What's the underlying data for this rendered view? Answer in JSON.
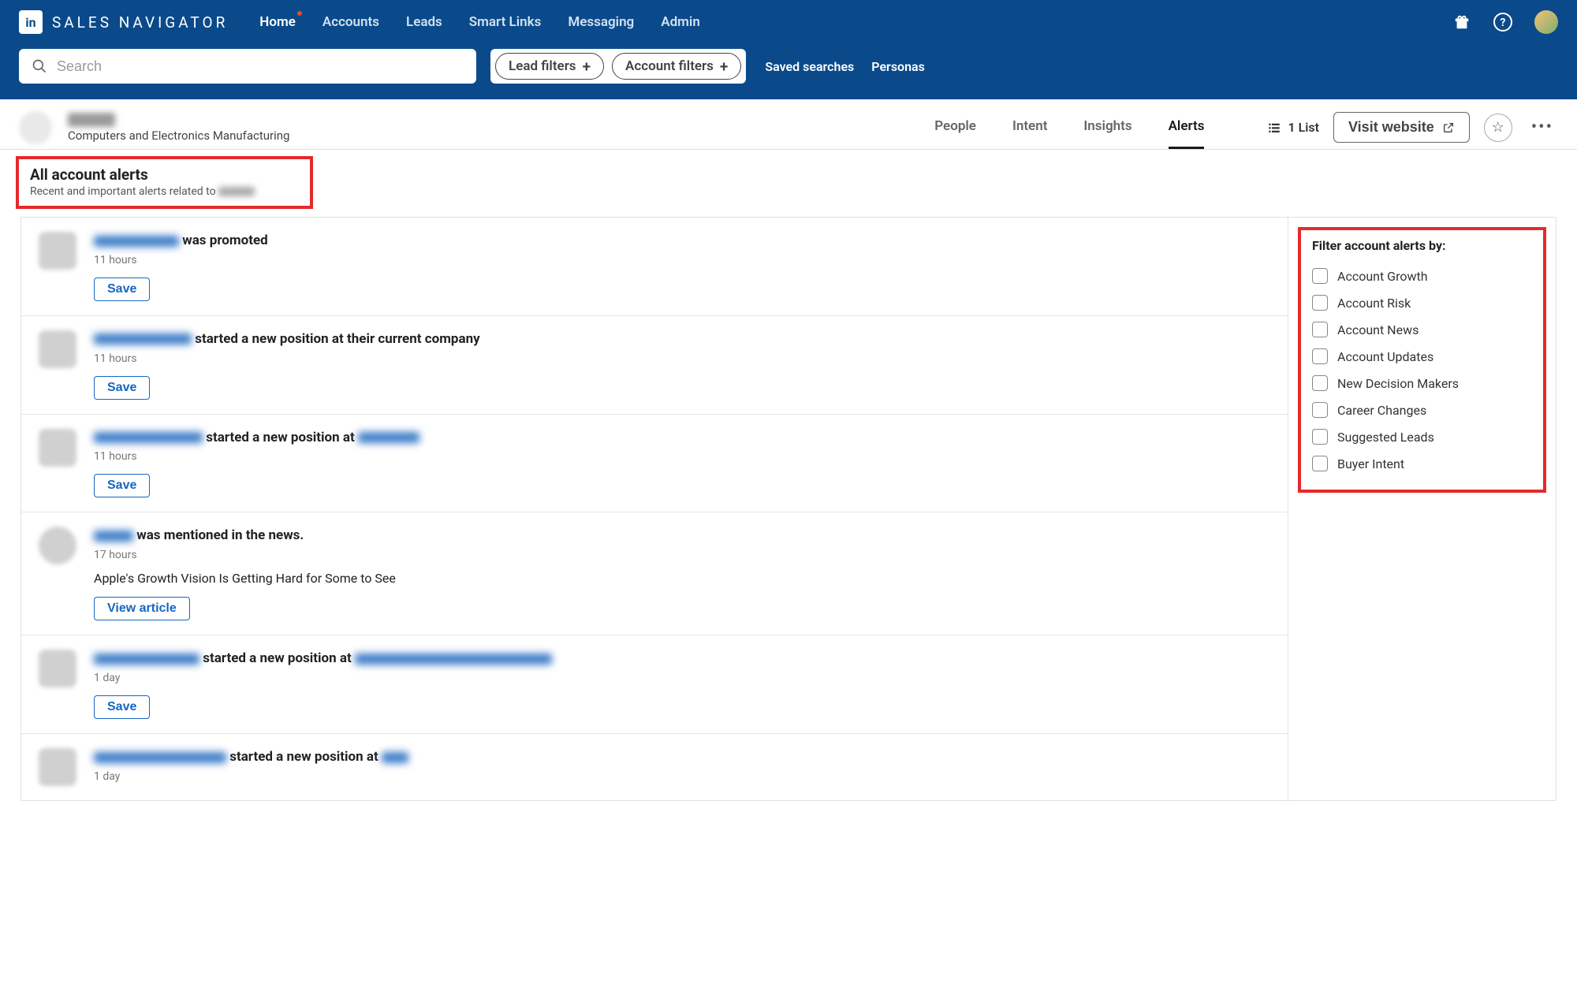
{
  "brand": {
    "logo_text": "SALES NAVIGATOR",
    "logo_abbr": "in"
  },
  "nav": {
    "items": [
      {
        "label": "Home",
        "active": true,
        "dot": true
      },
      {
        "label": "Accounts"
      },
      {
        "label": "Leads"
      },
      {
        "label": "Smart Links"
      },
      {
        "label": "Messaging"
      },
      {
        "label": "Admin"
      }
    ]
  },
  "search": {
    "placeholder": "Search",
    "lead_filters": "Lead filters",
    "account_filters": "Account filters",
    "saved_searches": "Saved searches",
    "personas": "Personas"
  },
  "account": {
    "industry": "Computers and Electronics Manufacturing",
    "tabs": [
      "People",
      "Intent",
      "Insights",
      "Alerts"
    ],
    "active_tab": "Alerts",
    "list_count": "1 List",
    "visit": "Visit website"
  },
  "alerts_head": {
    "title": "All account alerts",
    "subtitle_prefix": "Recent and important alerts related to"
  },
  "filters": {
    "title": "Filter account alerts by:",
    "items": [
      "Account Growth",
      "Account Risk",
      "Account News",
      "Account Updates",
      "New Decision Makers",
      "Career Changes",
      "Suggested Leads",
      "Buyer Intent"
    ]
  },
  "feed": [
    {
      "action": "was promoted",
      "time": "11 hours",
      "button": "Save",
      "lead_blur_w": 108,
      "company_blur_w": 0
    },
    {
      "action": "started a new position at their current company",
      "time": "11 hours",
      "button": "Save",
      "lead_blur_w": 124,
      "company_blur_w": 0
    },
    {
      "action": "started a new position at",
      "time": "11 hours",
      "button": "Save",
      "lead_blur_w": 138,
      "company_blur_w": 78
    },
    {
      "action": "was mentioned in the news.",
      "time": "17 hours",
      "button": "View article",
      "lead_blur_w": 50,
      "company_blur_w": 0,
      "snippet": "Apple's Growth Vision Is Getting Hard for Some to See"
    },
    {
      "action": "started a new position at",
      "time": "1 day",
      "button": "Save",
      "lead_blur_w": 134,
      "company_blur_w": 250
    },
    {
      "action": "started a new position at",
      "time": "1 day",
      "button": "",
      "lead_blur_w": 168,
      "company_blur_w": 34
    }
  ]
}
